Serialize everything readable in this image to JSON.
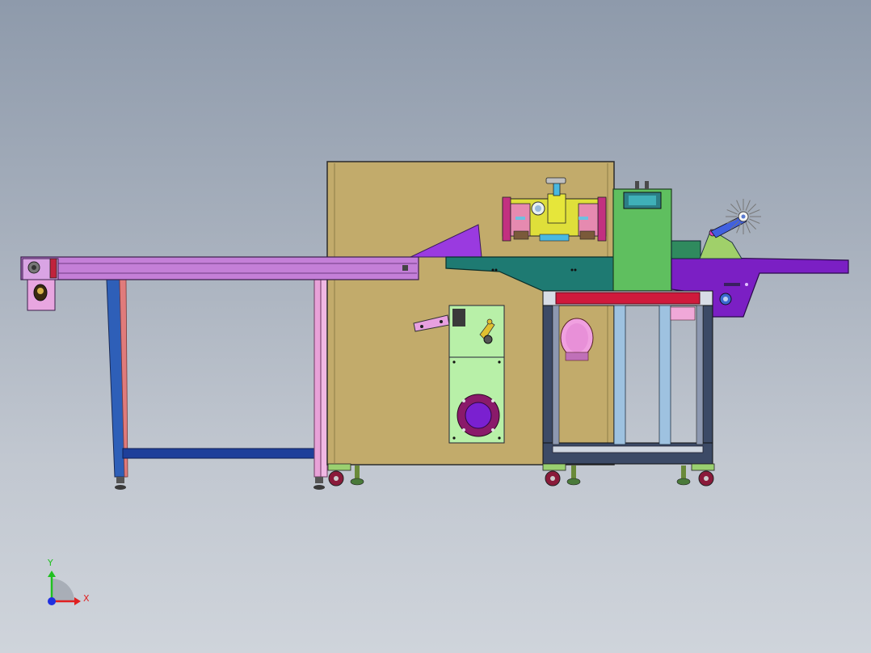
{
  "viewport": {
    "background_top": "#8e9aab",
    "background_bottom": "#cfd4db"
  },
  "model": {
    "frame_color": "#c2ab6b",
    "conveyor_color": "#c47fd8",
    "hmi_color": "#5fbf5f",
    "feed_plate_color": "#1e7a72",
    "outfeed_color": "#7b1fc4",
    "cabinet_frame_color": "#3c4a66",
    "cabinet_top_color": "#d01a3c"
  },
  "triad": {
    "x_label": "X",
    "y_label": "Y",
    "x_color": "#e02020",
    "y_color": "#20c020",
    "z_color": "#2030e0"
  }
}
